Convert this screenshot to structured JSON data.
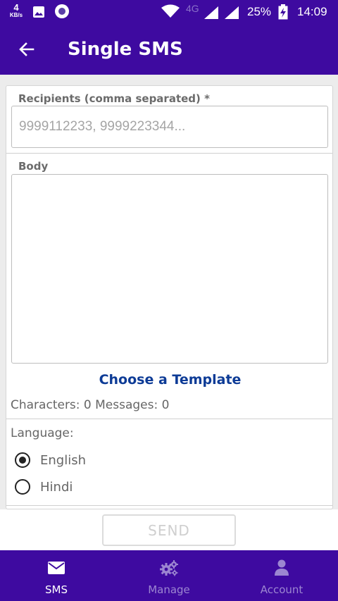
{
  "status_bar": {
    "net_speed_value": "4",
    "net_speed_unit": "KB/s",
    "network_type": "4G",
    "battery": "25%",
    "time": "14:09"
  },
  "app_bar": {
    "title": "Single SMS",
    "back_icon": "arrow-left-icon"
  },
  "form": {
    "recipients_label": "Recipients (comma separated) *",
    "recipients_placeholder": "9999112233, 9999223344...",
    "recipients_value": "",
    "body_label": "Body",
    "body_value": "",
    "choose_template": "Choose a Template",
    "counts": "Characters: 0 Messages: 0",
    "language_label": "Language:",
    "languages": [
      {
        "label": "English",
        "selected": true
      },
      {
        "label": "Hindi",
        "selected": false
      }
    ]
  },
  "send_button": "SEND",
  "bottom_nav": [
    {
      "label": "SMS",
      "icon": "envelope-icon",
      "active": true
    },
    {
      "label": "Manage",
      "icon": "gears-icon",
      "active": false
    },
    {
      "label": "Account",
      "icon": "user-icon",
      "active": false
    }
  ],
  "colors": {
    "primary": "#3e0aa0",
    "link": "#0d3b96",
    "nav_inactive": "#9c86d1"
  }
}
